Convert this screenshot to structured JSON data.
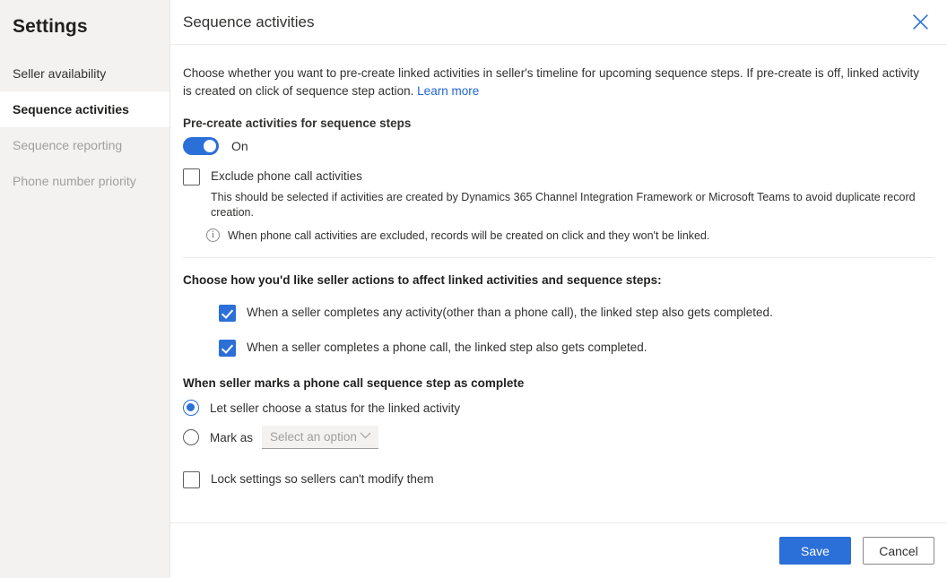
{
  "sidebar": {
    "title": "Settings",
    "items": [
      {
        "label": "Seller availability",
        "selected": false,
        "disabled": false
      },
      {
        "label": "Sequence activities",
        "selected": true,
        "disabled": false
      },
      {
        "label": "Sequence reporting",
        "selected": false,
        "disabled": true
      },
      {
        "label": "Phone number priority",
        "selected": false,
        "disabled": true
      }
    ]
  },
  "panel": {
    "title": "Sequence activities",
    "close_icon": "close-icon",
    "intro": "Choose whether you want to pre-create linked activities in seller's timeline for upcoming sequence steps. If pre-create is off, linked activity is created on click of sequence step action.",
    "intro_link": "Learn more"
  },
  "precreate": {
    "label": "Pre-create activities for sequence steps",
    "toggle_state": "On",
    "toggle_on": true,
    "accent_color": "#2b6fd8"
  },
  "exclude": {
    "checkbox_label": "Exclude phone call activities",
    "checked": false,
    "description": "This should be selected if activities are created by Dynamics 365 Channel Integration Framework or Microsoft Teams to avoid duplicate record creation.",
    "info_icon": "info-icon",
    "note": "When phone call activities are excluded, records will be created on click and they won't be linked."
  },
  "seller_actions": {
    "heading": "Choose how you'd like seller actions to affect linked activities and sequence steps:",
    "options": [
      {
        "label": "When a seller completes any activity(other than a phone call), the linked step also gets completed.",
        "checked": true
      },
      {
        "label": "When a seller completes a phone call, the linked step also gets completed.",
        "checked": true
      }
    ]
  },
  "mark_complete": {
    "heading": "When seller marks a phone call sequence step as complete",
    "options": [
      {
        "label": "Let seller choose a status for the linked activity",
        "selected": true
      },
      {
        "label": "Mark as",
        "selected": false
      }
    ],
    "dropdown": {
      "placeholder": "Select an option",
      "value": "Select an option",
      "chevron_icon": "chevron-down-icon"
    }
  },
  "lock": {
    "label": "Lock settings so sellers can't modify them",
    "checked": false
  },
  "footer": {
    "save_label": "Save",
    "cancel_label": "Cancel"
  }
}
